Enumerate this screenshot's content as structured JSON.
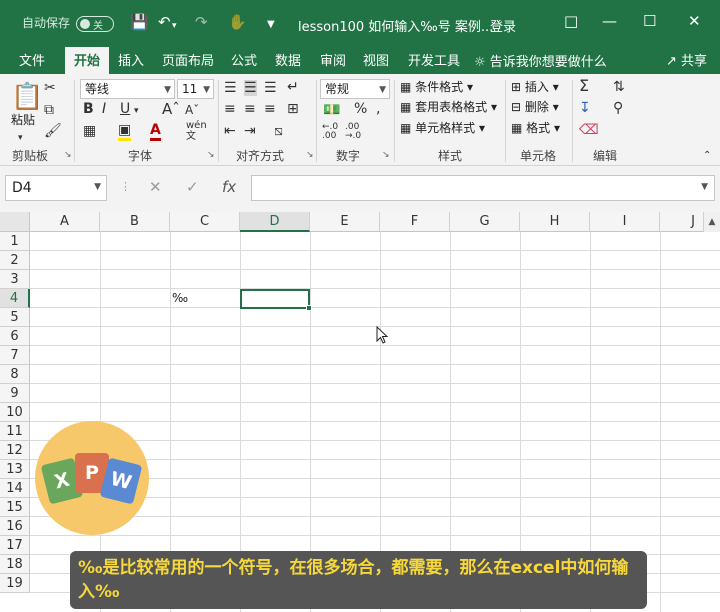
{
  "titlebar": {
    "autosave_label": "自动保存",
    "autosave_state": "关",
    "doc_title": "lesson100 如何输入‰号 案例...",
    "login": "登录"
  },
  "tabs": [
    "文件",
    "开始",
    "插入",
    "页面布局",
    "公式",
    "数据",
    "审阅",
    "视图",
    "开发工具"
  ],
  "tell_me": "告诉我你想要做什么",
  "share": "共享",
  "ribbon": {
    "clipboard": {
      "paste": "粘贴",
      "label": "剪贴板"
    },
    "font": {
      "name": "等线",
      "size": "11",
      "label": "字体"
    },
    "alignment": {
      "label": "对齐方式"
    },
    "number": {
      "format": "常规",
      "label": "数字"
    },
    "styles": {
      "conditional": "条件格式",
      "table": "套用表格格式",
      "cell": "单元格样式",
      "label": "样式"
    },
    "cells": {
      "insert": "插入",
      "delete": "删除",
      "format": "格式",
      "label": "单元格"
    },
    "editing": {
      "label": "编辑"
    }
  },
  "formula_bar": {
    "name_box": "D4",
    "fx": "fx",
    "content": ""
  },
  "columns": [
    "A",
    "B",
    "C",
    "D",
    "E",
    "F",
    "G",
    "H",
    "I",
    "J"
  ],
  "rows": [
    "1",
    "2",
    "3",
    "4",
    "5",
    "6",
    "7",
    "8",
    "9",
    "10",
    "11",
    "12",
    "13",
    "14",
    "15",
    "16",
    "17",
    "18",
    "19"
  ],
  "cells": {
    "C4": "‰"
  },
  "logo_letters": [
    "X",
    "P",
    "W"
  ],
  "caption": "‰是比较常用的一个符号，在很多场合，都需要，那么在excel中如何输入‰",
  "colors": {
    "accent": "#217346",
    "caption_bg": "#555555",
    "caption_text": "#f6d83a",
    "logo_bg": "#f7c86a"
  }
}
